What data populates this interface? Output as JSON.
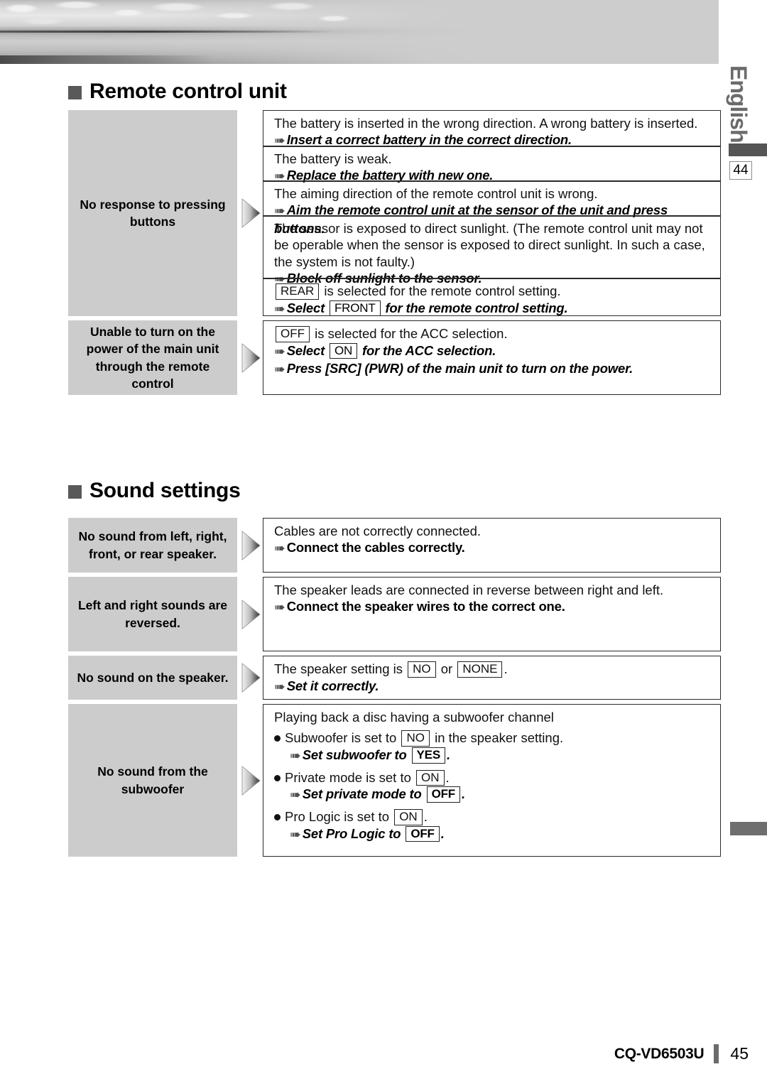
{
  "header": {
    "banner_alt": "grayscale seascape photo banner",
    "language_tab": "English",
    "page_marker": "44"
  },
  "footer": {
    "model": "CQ-VD6503U",
    "page_number": "45"
  },
  "sections": [
    {
      "id": "remote-control-unit",
      "title": "Remote control unit",
      "rows": [
        {
          "symptom": "No response to pressing buttons",
          "causes": [
            {
              "cause_parts": [
                {
                  "t": "text",
                  "v": "The battery is inserted in the wrong direction. A wrong battery is inserted."
                }
              ],
              "remedies": [
                {
                  "style": "bold-italic",
                  "parts": [
                    {
                      "t": "arrow"
                    },
                    {
                      "t": "text",
                      "v": "Insert a correct battery in the correct direction."
                    }
                  ]
                }
              ]
            },
            {
              "cause_parts": [
                {
                  "t": "text",
                  "v": "The battery is weak."
                }
              ],
              "remedies": [
                {
                  "style": "bold-italic",
                  "parts": [
                    {
                      "t": "arrow"
                    },
                    {
                      "t": "text",
                      "v": "Replace the battery with new one."
                    }
                  ]
                }
              ]
            },
            {
              "cause_parts": [
                {
                  "t": "text",
                  "v": "The aiming direction of the remote control unit is wrong."
                }
              ],
              "remedies": [
                {
                  "style": "bold-italic",
                  "parts": [
                    {
                      "t": "arrow"
                    },
                    {
                      "t": "text",
                      "v": "Aim the remote control unit at the sensor of the unit and press buttons."
                    }
                  ]
                }
              ]
            },
            {
              "cause_parts": [
                {
                  "t": "text",
                  "v": "The sensor is exposed to direct sunlight. (The remote control unit may not be operable when the sensor is exposed to direct sunlight. In such a case, the system is not faulty.)"
                }
              ],
              "remedies": [
                {
                  "style": "bold-italic",
                  "parts": [
                    {
                      "t": "arrow"
                    },
                    {
                      "t": "text",
                      "v": "Block off sunlight to the sensor."
                    }
                  ]
                }
              ]
            },
            {
              "cause_parts": [
                {
                  "t": "key",
                  "v": "REAR"
                },
                {
                  "t": "text",
                  "v": " is selected for the remote control setting."
                }
              ],
              "remedies": [
                {
                  "style": "bold-italic",
                  "parts": [
                    {
                      "t": "arrow"
                    },
                    {
                      "t": "text",
                      "v": "Select "
                    },
                    {
                      "t": "key",
                      "v": "FRONT"
                    },
                    {
                      "t": "text",
                      "v": " for the remote control setting."
                    }
                  ]
                }
              ]
            }
          ]
        },
        {
          "symptom": "Unable to turn on the power of the main unit through the remote control",
          "causes": [
            {
              "cause_parts": [
                {
                  "t": "key",
                  "v": "OFF"
                },
                {
                  "t": "text",
                  "v": " is selected for the ACC selection."
                }
              ],
              "remedies": [
                {
                  "style": "bold-italic",
                  "parts": [
                    {
                      "t": "arrow"
                    },
                    {
                      "t": "text",
                      "v": "Select "
                    },
                    {
                      "t": "key",
                      "v": "ON"
                    },
                    {
                      "t": "text",
                      "v": " for the ACC selection."
                    }
                  ]
                },
                {
                  "style": "bold-italic",
                  "parts": [
                    {
                      "t": "arrow"
                    },
                    {
                      "t": "text",
                      "v": "Press [SRC] (PWR) of the main unit to turn on the power."
                    }
                  ]
                }
              ]
            }
          ]
        }
      ]
    },
    {
      "id": "sound-settings",
      "title": "Sound settings",
      "rows": [
        {
          "symptom": "No sound from left, right, front, or rear speaker.",
          "causes": [
            {
              "cause_parts": [
                {
                  "t": "text",
                  "v": "Cables are not correctly connected."
                }
              ],
              "remedies": [
                {
                  "style": "bold",
                  "parts": [
                    {
                      "t": "arrow"
                    },
                    {
                      "t": "text",
                      "v": "Connect the cables correctly."
                    }
                  ]
                }
              ]
            }
          ]
        },
        {
          "symptom": "Left and right sounds are reversed.",
          "causes": [
            {
              "cause_parts": [
                {
                  "t": "text",
                  "v": "The speaker leads are connected in reverse between right and left."
                }
              ],
              "remedies": [
                {
                  "style": "bold",
                  "parts": [
                    {
                      "t": "arrow"
                    },
                    {
                      "t": "text",
                      "v": "Connect the speaker wires to the correct one."
                    }
                  ]
                }
              ]
            }
          ]
        },
        {
          "symptom": "No sound on the speaker.",
          "causes": [
            {
              "cause_parts": [
                {
                  "t": "text",
                  "v": "The speaker setting is "
                },
                {
                  "t": "key",
                  "v": "NO"
                },
                {
                  "t": "text",
                  "v": " or "
                },
                {
                  "t": "key",
                  "v": "NONE"
                },
                {
                  "t": "text",
                  "v": "."
                }
              ],
              "remedies": [
                {
                  "style": "bold-italic",
                  "parts": [
                    {
                      "t": "arrow"
                    },
                    {
                      "t": "text",
                      "v": "Set it correctly."
                    }
                  ]
                }
              ]
            }
          ]
        },
        {
          "symptom": "No sound from the subwoofer",
          "causes": [
            {
              "cause_parts": [
                {
                  "t": "text",
                  "v": "Playing back a disc having a subwoofer channel"
                }
              ],
              "bullets": [
                {
                  "cause_parts": [
                    {
                      "t": "bullet"
                    },
                    {
                      "t": "text",
                      "v": "Subwoofer is set to "
                    },
                    {
                      "t": "key",
                      "v": "NO"
                    },
                    {
                      "t": "text",
                      "v": " in the speaker setting."
                    }
                  ],
                  "remedy_parts": [
                    {
                      "t": "arrow"
                    },
                    {
                      "t": "text",
                      "v": "Set subwoofer to "
                    },
                    {
                      "t": "keyb",
                      "v": "YES"
                    },
                    {
                      "t": "text",
                      "v": "."
                    }
                  ]
                },
                {
                  "cause_parts": [
                    {
                      "t": "bullet"
                    },
                    {
                      "t": "text",
                      "v": "Private mode is set to "
                    },
                    {
                      "t": "key",
                      "v": "ON"
                    },
                    {
                      "t": "text",
                      "v": "."
                    }
                  ],
                  "remedy_parts": [
                    {
                      "t": "arrow"
                    },
                    {
                      "t": "text",
                      "v": "Set private mode to "
                    },
                    {
                      "t": "keyb",
                      "v": "OFF"
                    },
                    {
                      "t": "text",
                      "v": "."
                    }
                  ]
                },
                {
                  "cause_parts": [
                    {
                      "t": "bullet"
                    },
                    {
                      "t": "text",
                      "v": "Pro Logic is set to "
                    },
                    {
                      "t": "key",
                      "v": "ON"
                    },
                    {
                      "t": "text",
                      "v": "."
                    }
                  ],
                  "remedy_parts": [
                    {
                      "t": "arrow"
                    },
                    {
                      "t": "text",
                      "v": "Set Pro Logic to "
                    },
                    {
                      "t": "keyb",
                      "v": "OFF"
                    },
                    {
                      "t": "text",
                      "v": "."
                    }
                  ]
                }
              ]
            }
          ]
        }
      ]
    }
  ]
}
